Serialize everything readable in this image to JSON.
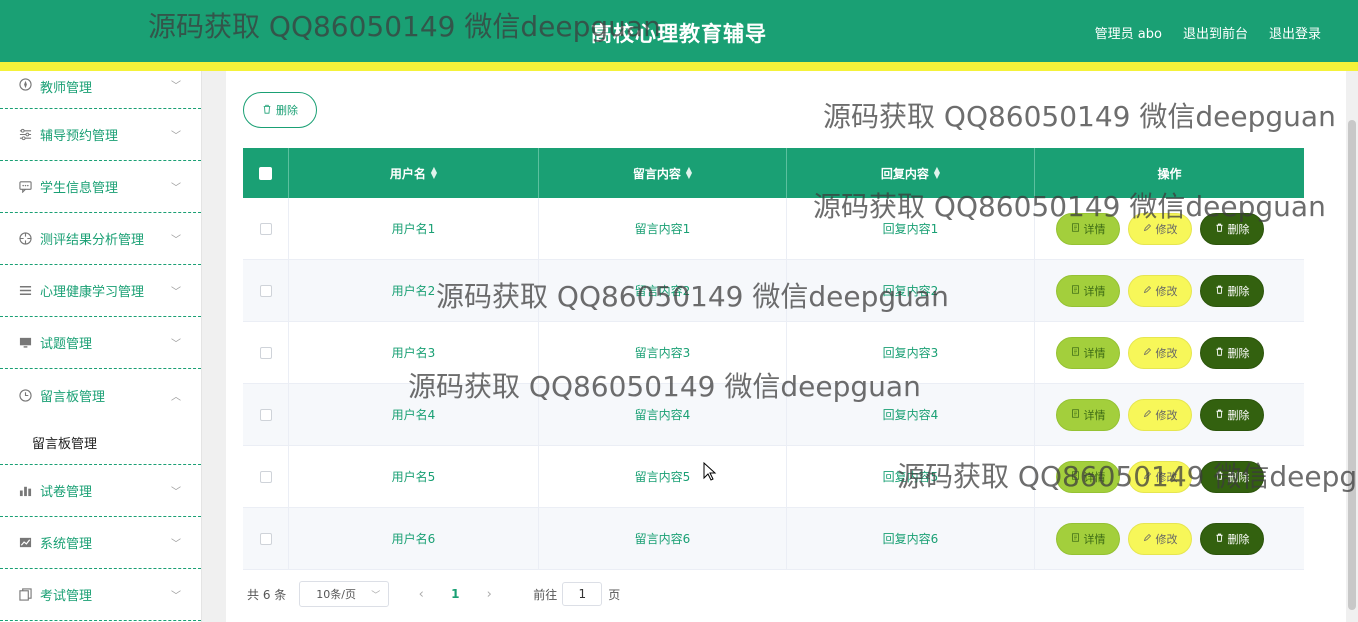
{
  "header": {
    "title": "高校心理教育辅导",
    "nav": [
      "管理员 abo",
      "退出到前台",
      "退出登录"
    ]
  },
  "sidebar": {
    "items": [
      {
        "label": "教师管理",
        "icon": "compass-icon"
      },
      {
        "label": "辅导预约管理",
        "icon": "sliders-icon"
      },
      {
        "label": "学生信息管理",
        "icon": "chat-icon"
      },
      {
        "label": "测评结果分析管理",
        "icon": "target-icon"
      },
      {
        "label": "心理健康学习管理",
        "icon": "list-icon"
      },
      {
        "label": "试题管理",
        "icon": "monitor-icon"
      },
      {
        "label": "留言板管理",
        "icon": "clock-icon"
      },
      {
        "label": "试卷管理",
        "icon": "bar-chart-icon"
      },
      {
        "label": "系统管理",
        "icon": "line-chart-icon"
      },
      {
        "label": "考试管理",
        "icon": "copy-icon"
      }
    ],
    "submenu": "留言板管理"
  },
  "toolbar": {
    "delete_label": "删除"
  },
  "table": {
    "headers": [
      "用户名",
      "留言内容",
      "回复内容",
      "操作"
    ],
    "rows": [
      [
        "用户名1",
        "留言内容1",
        "回复内容1"
      ],
      [
        "用户名2",
        "留言内容2",
        "回复内容2"
      ],
      [
        "用户名3",
        "留言内容3",
        "回复内容3"
      ],
      [
        "用户名4",
        "留言内容4",
        "回复内容4"
      ],
      [
        "用户名5",
        "留言内容5",
        "回复内容5"
      ],
      [
        "用户名6",
        "留言内容6",
        "回复内容6"
      ]
    ],
    "actions": {
      "detail": "详情",
      "edit": "修改",
      "delete": "删除"
    }
  },
  "pagination": {
    "total": "共 6 条",
    "page_size": "10条/页",
    "current": "1",
    "goto_prefix": "前往",
    "goto_value": "1",
    "goto_suffix": "页"
  },
  "watermark": "源码获取 QQ86050149 微信deepguan",
  "colors": {
    "primary": "#1aa074",
    "stripe": "#f5f23a",
    "detail": "#a3cf3c",
    "edit": "#f7f759",
    "delete": "#33610f"
  }
}
